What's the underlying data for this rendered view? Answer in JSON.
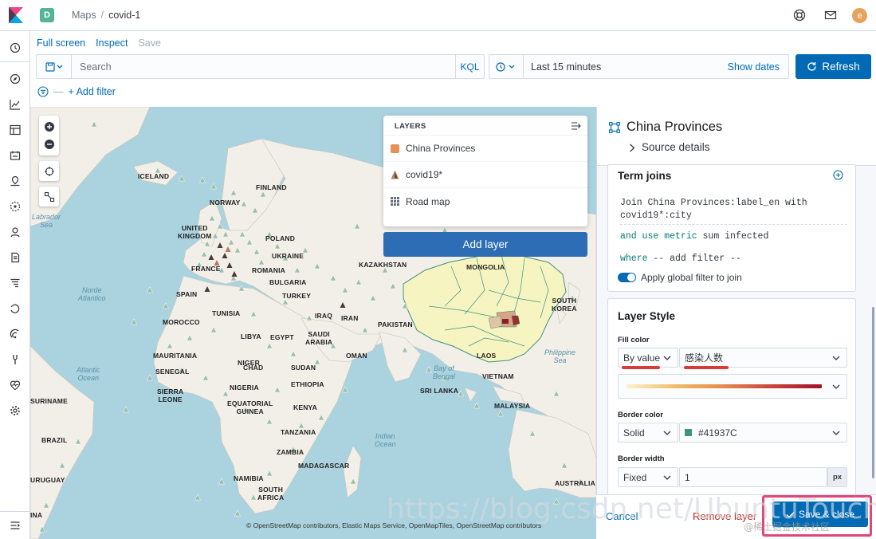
{
  "header": {
    "space_initial": "D",
    "breadcrumb": [
      "Maps",
      "covid-1"
    ],
    "avatar_initial": "e"
  },
  "toolbar": {
    "links": [
      {
        "label": "Full screen",
        "enabled": true
      },
      {
        "label": "Inspect",
        "enabled": true
      },
      {
        "label": "Save",
        "enabled": false
      }
    ],
    "search_placeholder": "Search",
    "kql_label": "KQL",
    "time_range": "Last 15 minutes",
    "show_dates": "Show dates",
    "refresh_label": "Refresh",
    "add_filter": "+ Add filter"
  },
  "layers_panel": {
    "title": "LAYERS",
    "items": [
      {
        "label": "China Provinces",
        "icon": "orange-square-icon",
        "color": "#e7915a"
      },
      {
        "label": "covid19*",
        "icon": "triangle-marker-icon",
        "color": "#b0806a"
      },
      {
        "label": "Road map",
        "icon": "grid-tiles-icon",
        "color": "#69707d"
      }
    ],
    "add_layer": "Add layer"
  },
  "map": {
    "labels": [
      "ICELAND",
      "FINLAND",
      "NORWAY",
      "UNITED KINGDOM",
      "POLAND",
      "UKRAINE",
      "FRANCE",
      "ROMANIA",
      "BULGARIA",
      "SPAIN",
      "TURKEY",
      "MOROCCO",
      "TUNISIA",
      "IRAQ",
      "IRAN",
      "KAZAKHSTAN",
      "MONGOLIA",
      "PAKISTAN",
      "LIBYA",
      "EGYPT",
      "SAUDI ARABIA",
      "OMAN",
      "MAURITANIA",
      "NIGER",
      "CHAD",
      "SUDAN",
      "SENEGAL",
      "SIERRA LEONE",
      "NIGERIA",
      "ETHIOPIA",
      "EQUATORIAL GUINEA",
      "KENYA",
      "TANZANIA",
      "LAOS",
      "VIETNAM",
      "SRI LANKA",
      "MALAYSIA",
      "SOUTH KOREA",
      "ZAMBIA",
      "MADAGASCAR",
      "NAMIBIA",
      "SOUTH AFRICA",
      "BRAZIL",
      "AUSTRALIA",
      "SURINAME",
      "URUGUAY",
      "INA"
    ],
    "oceans": [
      "Labrador Sea",
      "Norde Atlantico",
      "Atlantic Ocean",
      "Bay of Bengal",
      "Indian Ocean",
      "Philippine Sea"
    ],
    "attribution": "© OpenStreetMap contributors, Elastic Maps Service, OpenMapTiles, OpenStreetMap contributors"
  },
  "editor": {
    "title": "China Provinces",
    "source_details": "Source details",
    "term_joins": {
      "heading": "Term joins",
      "join_line": "Join China Provinces:label_en with covid19*:city",
      "metric_prefix": "and use metric",
      "metric_value": "sum infected",
      "where_prefix": "where",
      "where_value": "-- add filter --",
      "global_filter": "Apply global filter to join"
    },
    "layer_style": {
      "heading": "Layer Style",
      "fill_color_label": "Fill color",
      "fill_mode": "By value",
      "fill_field": "感染人数",
      "border_color_label": "Border color",
      "border_mode": "Solid",
      "border_color": "#41937C",
      "border_width_label": "Border width",
      "border_width_mode": "Fixed",
      "border_width_value": "1",
      "border_width_unit": "px"
    },
    "footer": {
      "cancel": "Cancel",
      "remove_layer": "Remove layer",
      "save_close": "Save & close"
    }
  },
  "watermark": {
    "text": "https://blog.csdn.net/UbuntuTouch",
    "credit": "@稀土掘金技术社区"
  }
}
